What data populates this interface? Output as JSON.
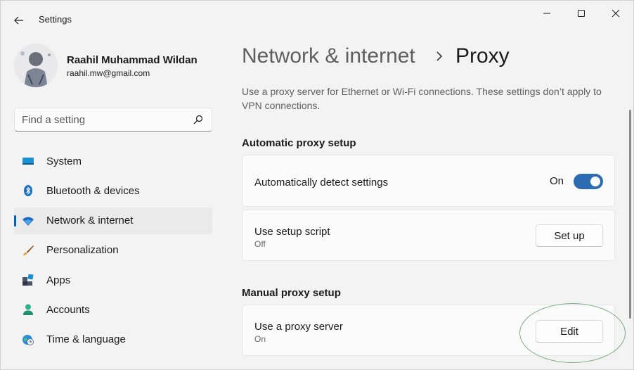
{
  "window": {
    "app_title": "Settings"
  },
  "profile": {
    "name": "Raahil Muhammad Wildan",
    "email": "raahil.mw@gmail.com"
  },
  "search": {
    "placeholder": "Find a setting"
  },
  "sidebar": {
    "items": [
      {
        "label": "System",
        "icon": "monitor-icon",
        "active": false
      },
      {
        "label": "Bluetooth & devices",
        "icon": "bluetooth-icon",
        "active": false
      },
      {
        "label": "Network & internet",
        "icon": "wifi-icon",
        "active": true
      },
      {
        "label": "Personalization",
        "icon": "brush-icon",
        "active": false
      },
      {
        "label": "Apps",
        "icon": "apps-icon",
        "active": false
      },
      {
        "label": "Accounts",
        "icon": "person-icon",
        "active": false
      },
      {
        "label": "Time & language",
        "icon": "globe-clock-icon",
        "active": false
      }
    ]
  },
  "breadcrumb": {
    "parent": "Network & internet",
    "current": "Proxy"
  },
  "description": "Use a proxy server for Ethernet or Wi-Fi connections. These settings don’t apply to VPN connections.",
  "automatic": {
    "section_title": "Automatic proxy setup",
    "detect": {
      "title": "Automatically detect settings",
      "state": "On"
    },
    "script": {
      "title": "Use setup script",
      "subtitle": "Off",
      "button": "Set up"
    }
  },
  "manual": {
    "section_title": "Manual proxy setup",
    "server": {
      "title": "Use a proxy server",
      "subtitle": "On",
      "button": "Edit"
    }
  },
  "colors": {
    "accent": "#2b6cb3",
    "active_indicator": "#005fb8",
    "highlight_ellipse": "#7aa986"
  }
}
